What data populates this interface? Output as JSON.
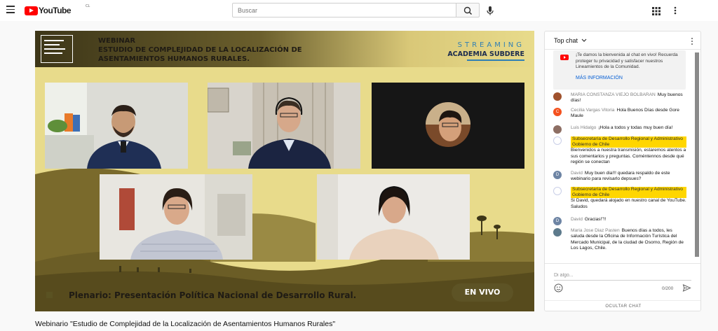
{
  "header": {
    "logo_text": "YouTube",
    "country_code": "CL",
    "search_placeholder": "Buscar",
    "icons": [
      "menu-icon",
      "search-icon",
      "microphone-icon",
      "apps-icon",
      "more-vert-icon"
    ]
  },
  "video": {
    "overlay": {
      "webinar_label": "WEBINAR",
      "title_line1": "ESTUDIO DE COMPLEJIDAD DE LA LOCALIZACIÓN DE",
      "title_line2": "ASENTAMIENTOS HUMANOS RURALES.",
      "streaming_label": "STREAMING",
      "academia_label": "ACADEMIA SUBDERE",
      "plenario_text": "Plenario: Presentación Política Nacional de Desarrollo Rural.",
      "live_badge": "EN VIVO"
    },
    "title": "Webinario \"Estudio de Complejidad de la Localización de Asentamientos Humanos Rurales\""
  },
  "colors": {
    "youtube_red": "#ff0000",
    "video_background": "#e8db8b",
    "video_dark_olive": "#5d5325",
    "chat_highlight": "#ffd600",
    "link_blue": "#065fd4"
  },
  "chat": {
    "header_title": "Top chat",
    "welcome": {
      "text": "¡Te damos la bienvenida al chat en vivo! Recuerda proteger tu privacidad y satisfacer nuestros Lineamientos de la Comunidad.",
      "link": "MÁS INFORMACIÓN"
    },
    "messages": [
      {
        "avatar": "",
        "avatar_color": "#a0522d",
        "author": "MARIA CONSTANZA VIEJO BOLBARAN",
        "text": "Muy buenos días!",
        "highlight": false
      },
      {
        "avatar": "C",
        "avatar_color": "#f4511e",
        "author": "Cecilia Vargas Vitoria",
        "text": "Hola Buenos Días desde Gore Maule",
        "highlight": false
      },
      {
        "avatar": "",
        "avatar_color": "#8d6e63",
        "author": "Luis Hidalgo",
        "text": "¡Hola a todos y todas muy buen día!",
        "highlight": false
      },
      {
        "avatar": "",
        "avatar_color": "#c9cfe8",
        "author": "Subsecretaría de Desarrollo Regional y Administrativo Gobierno de Chile",
        "text": "Bienvenidos a nuestra transmisión, estaremos atentos a sus comentarios y preguntas. Coméntennos desde qué región se conectan",
        "highlight": true
      },
      {
        "avatar": "D",
        "avatar_color": "#6d84a4",
        "author": "David",
        "text": "Muy buen dia!!! quedara respaldo de este webinario para revisarlo depsues?",
        "highlight": false
      },
      {
        "avatar": "",
        "avatar_color": "#c9cfe8",
        "author": "Subsecretaría de Desarrollo Regional y Administrativo Gobierno de Chile",
        "text": "Si David, quedará alojado en nuestro canal de YouTube. Saludos",
        "highlight": true
      },
      {
        "avatar": "D",
        "avatar_color": "#6d84a4",
        "author": "David",
        "text": "Gracias!\"!!",
        "highlight": false
      },
      {
        "avatar": "",
        "avatar_color": "#5d7a8c",
        "author": "Maria Jose Diaz Pasten",
        "text": "Buenos días a todos, les saluda desde la Oficina de Información Turística del Mercado Municipal, de la ciudad de Osorno, Región de Los Lagos, Chile.",
        "highlight": false
      }
    ],
    "input_placeholder": "Di algo...",
    "char_count": "0/200",
    "hide_chat_label": "OCULTAR CHAT"
  }
}
